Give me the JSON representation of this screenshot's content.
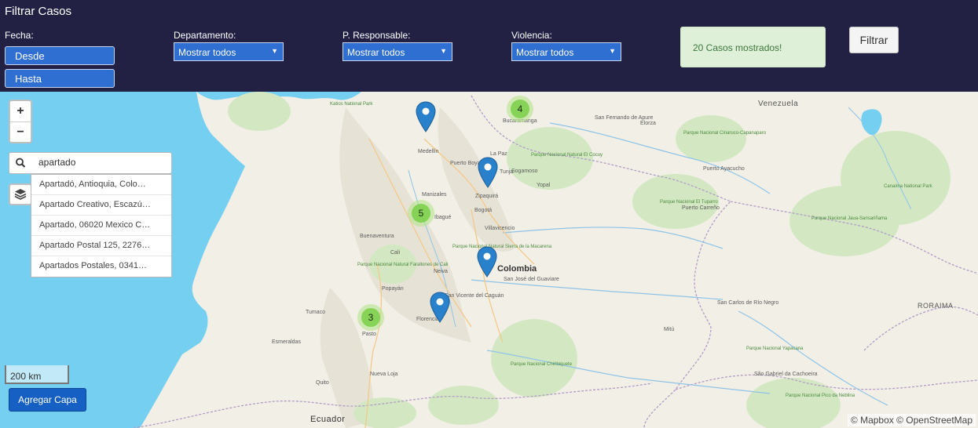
{
  "header": {
    "title": "Filtrar Casos",
    "fecha_label": "Fecha:",
    "desde_label": "Desde",
    "hasta_label": "Hasta",
    "departamento_label": "Departamento:",
    "departamento_value": "Mostrar todos",
    "responsable_label": "P. Responsable:",
    "responsable_value": "Mostrar todos",
    "violencia_label": "Violencia:",
    "violencia_value": "Mostrar todos",
    "alert_text": "20 Casos mostrados!",
    "filter_button": "Filtrar"
  },
  "map": {
    "zoom_in": "+",
    "zoom_out": "−",
    "search_value": "apartado",
    "suggestions": [
      "Apartadó, Antioquia, Colo…",
      "Apartado Creativo, Escazú…",
      "Apartado, 06020 Mexico C…",
      "Apartado Postal 125, 2276…",
      "Apartados Postales, 0341…"
    ],
    "scale_label": "200 km",
    "add_layer_button": "Agregar Capa",
    "attribution": "© Mapbox © OpenStreetMap",
    "clusters": [
      {
        "count": "4"
      },
      {
        "count": "5"
      },
      {
        "count": "3"
      }
    ],
    "labels": {
      "colombia": "Colombia",
      "venezuela": "Venezuela",
      "ecuador": "Ecuador",
      "roraima": "RORAIMA",
      "medellin": "Medellín",
      "bogota": "Bogotá",
      "cali": "Cali",
      "pasto": "Pasto",
      "quito": "Quito",
      "villavicencio": "Villavicencio",
      "ibague": "Ibagué",
      "manizales": "Manizales",
      "tunja": "Tunja",
      "buenaventura": "Buenaventura",
      "popayan": "Popayán",
      "neiva": "Neiva",
      "florencia": "Florencia",
      "bucaramanga": "Bucaramanga",
      "yopal": "Yopal",
      "la_paz": "La Paz",
      "sogamoso": "Sogamoso",
      "zipaquira": "Zipaquirá",
      "puerto_boyaca": "Puerto Boyacá",
      "san_fernando": "San Fernando de Apure",
      "elorza": "Elorza",
      "puerto_ayacucho": "Puerto Ayacucho",
      "puerto_carreno": "Puerto Carreño",
      "san_jose": "San José del Guaviare",
      "tumaco": "Tumaco",
      "esmeraldas": "Esmeraldas",
      "san_carlos": "San Carlos de Río Negro",
      "sao_gabriel": "São Gabriel da Cachoeira",
      "mitu": "Mitú",
      "san_vicente": "San Vicente del Caguán",
      "nueva_loja": "Nueva Loja",
      "park_pinares": "Parque Nacional Cinaruco-Capanaparo",
      "park_tuparro": "Parque Nacional El Tuparro",
      "park_chiribiquete": "Parque Nacional Chiribiquete",
      "park_canaima": "Canaima National Park",
      "park_jaua": "Parque Nacional Jaua-Sarisariñama",
      "park_cocuy": "Parque Nacional Natural El Cocuy",
      "park_farallones": "Parque Nacional Natural Farallones de Cali",
      "park_pico": "Parque Nacional Pico da Neblina",
      "park_yapacana": "Parque Nacional Yapacana",
      "park_macarena": "Parque Nacional Natural Sierra de la Macarena",
      "park_katios": "Katios National Park"
    }
  },
  "colors": {
    "header_bg": "#222144",
    "select_bg": "#2f6fd2",
    "alert_bg": "#dff0d8",
    "alert_text": "#3c763d",
    "marker": "#2a81cb",
    "cluster": "#6ecc39",
    "water": "#75cff0",
    "land": "#f1efe6",
    "park": "#d3e8c2"
  }
}
